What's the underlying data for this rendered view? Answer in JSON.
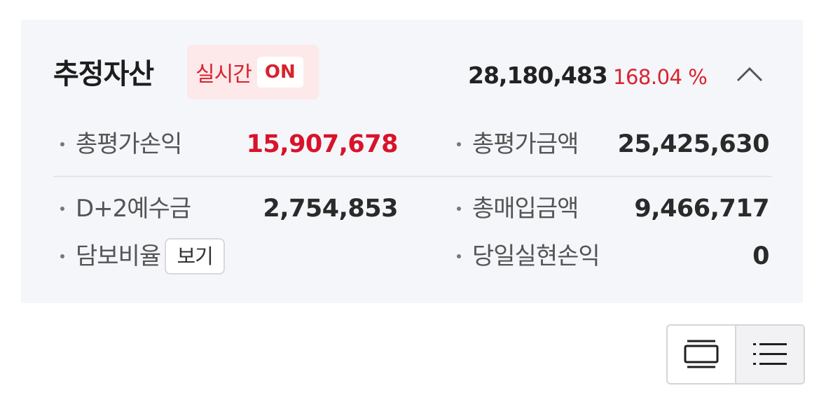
{
  "header": {
    "title": "추정자산",
    "realtime_label": "실시간",
    "realtime_state": "ON",
    "total_assets": "28,180,483",
    "return_rate": "168.04 %"
  },
  "rows": [
    {
      "left_label": "총평가손익",
      "left_value": "15,907,678",
      "right_label": "총평가금액",
      "right_value": "25,425,630"
    },
    {
      "left_label": "D+2예수금",
      "left_value": "2,754,853",
      "right_label": "총매입금액",
      "right_value": "9,466,717"
    },
    {
      "left_label": "담보비율",
      "left_button": "보기",
      "right_label": "당일실현손익",
      "right_value": "0"
    }
  ],
  "colors": {
    "accent_red": "#d8132a",
    "card_bg": "#f5f6fa"
  },
  "icons": {
    "collapse": "chevron-up-icon",
    "card_view": "card-view-icon",
    "list_view": "list-view-icon"
  }
}
